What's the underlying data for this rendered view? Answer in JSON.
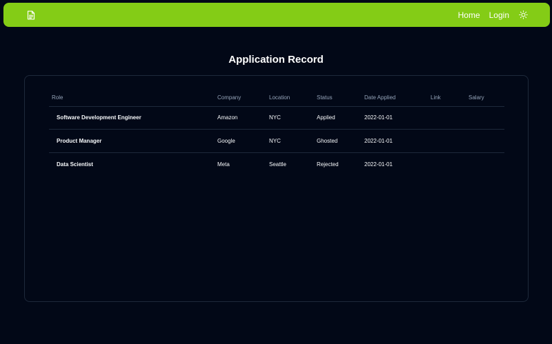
{
  "nav": {
    "logo_icon": "document-icon",
    "links": [
      "Home",
      "Login"
    ],
    "theme_icon": "sun-icon",
    "accent_color": "#84cc16"
  },
  "page": {
    "title": "Application Record",
    "background": "#020817"
  },
  "table": {
    "columns": [
      "Role",
      "Company",
      "Location",
      "Status",
      "Date Applied",
      "Link",
      "Salary"
    ],
    "rows": [
      {
        "role": "Software Development Engineer",
        "company": "Amazon",
        "location": "NYC",
        "status": "Applied",
        "date": "2022-01-01",
        "link": "",
        "salary": ""
      },
      {
        "role": "Product Manager",
        "company": "Google",
        "location": "NYC",
        "status": "Ghosted",
        "date": "2022-01-01",
        "link": "",
        "salary": ""
      },
      {
        "role": "Data Scientist",
        "company": "Meta",
        "location": "Seattle",
        "status": "Rejected",
        "date": "2022-01-01",
        "link": "",
        "salary": ""
      }
    ]
  }
}
